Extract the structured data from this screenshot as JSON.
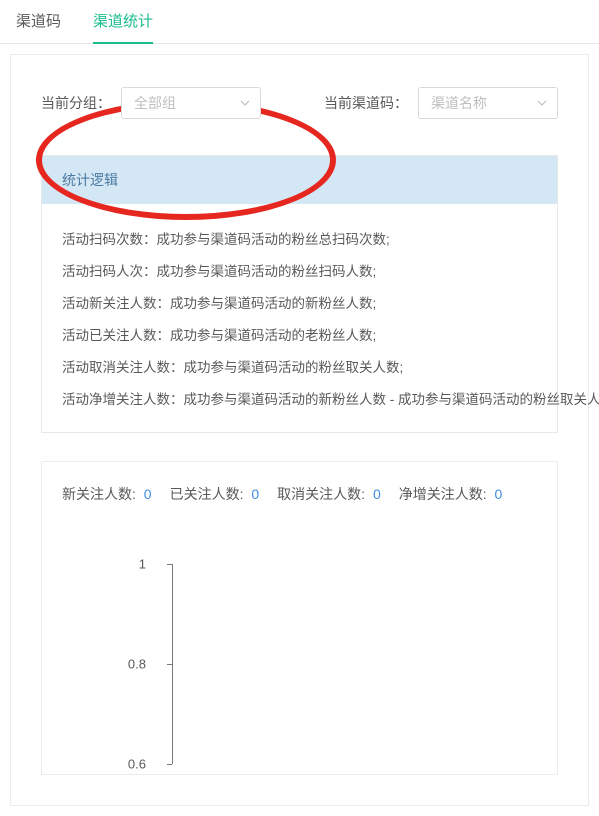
{
  "tabs": {
    "t0": "渠道码",
    "t1": "渠道统计"
  },
  "filters": {
    "group_label": "当前分组：",
    "group_value": "全部组",
    "code_label": "当前渠道码：",
    "code_value": "渠道名称"
  },
  "logic": {
    "title": "统计逻辑",
    "lines": [
      "活动扫码次数：成功参与渠道码活动的粉丝总扫码次数;",
      "活动扫码人次：成功参与渠道码活动的粉丝扫码人数;",
      "活动新关注人数：成功参与渠道码活动的新粉丝人数;",
      "活动已关注人数：成功参与渠道码活动的老粉丝人数;",
      "活动取消关注人数：成功参与渠道码活动的粉丝取关人数;",
      "活动净增关注人数：成功参与渠道码活动的新粉丝人数 - 成功参与渠道码活动的粉丝取关人数;"
    ]
  },
  "legend": {
    "new_label": "新关注人数:",
    "new_value": "0",
    "exist_label": "已关注人数:",
    "exist_value": "0",
    "cancel_label": "取消关注人数:",
    "cancel_value": "0",
    "net_label": "净增关注人数:",
    "net_value": "0"
  },
  "chart_data": {
    "type": "line",
    "title": "",
    "xlabel": "",
    "ylabel": "",
    "ylim": [
      0,
      1
    ],
    "yticks": [
      1,
      0.8,
      0.6
    ],
    "categories": [],
    "series": [
      {
        "name": "新关注人数",
        "values": []
      },
      {
        "name": "已关注人数",
        "values": []
      },
      {
        "name": "取消关注人数",
        "values": []
      },
      {
        "name": "净增关注人数",
        "values": []
      }
    ]
  }
}
